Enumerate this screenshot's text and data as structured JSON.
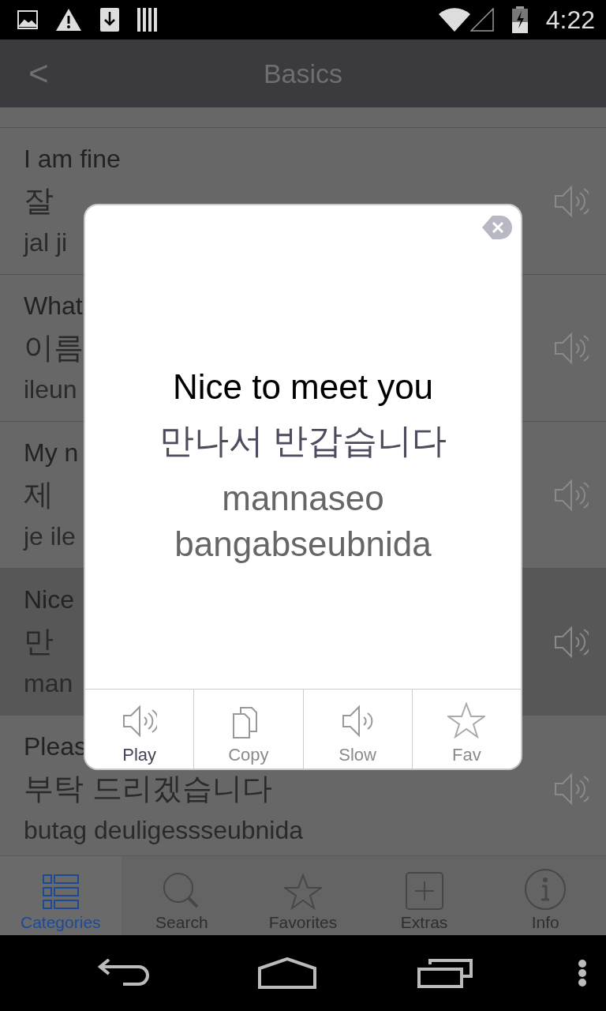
{
  "status_bar": {
    "time": "4:22"
  },
  "header": {
    "back": "<",
    "title": "Basics"
  },
  "phrases": [
    {
      "english": "I am fine",
      "korean": "잘",
      "romanization": "jal ji",
      "highlighted": false
    },
    {
      "english": "What",
      "korean": "이름",
      "romanization": "ileun",
      "highlighted": false
    },
    {
      "english": "My n",
      "korean": "제",
      "romanization": "je ile",
      "highlighted": false
    },
    {
      "english": "Nice",
      "korean": "만",
      "romanization": "man",
      "highlighted": true
    },
    {
      "english": "Pleas",
      "korean": "부탁 드리겠습니다",
      "romanization": "butag deuligessseubnida",
      "highlighted": false
    }
  ],
  "dialog": {
    "english": "Nice to meet you",
    "korean": "만나서 반갑습니다",
    "romanization": "mannaseo bangabseubnida",
    "actions": [
      {
        "kind": "play",
        "label": "Play",
        "highlighted": true
      },
      {
        "kind": "copy",
        "label": "Copy",
        "highlighted": false
      },
      {
        "kind": "slow",
        "label": "Slow",
        "highlighted": false
      },
      {
        "kind": "fav",
        "label": "Fav",
        "highlighted": false
      }
    ]
  },
  "tabs": [
    {
      "kind": "categories",
      "label": "Categories",
      "selected": true
    },
    {
      "kind": "search",
      "label": "Search",
      "selected": false
    },
    {
      "kind": "favorites",
      "label": "Favorites",
      "selected": false
    },
    {
      "kind": "extras",
      "label": "Extras",
      "selected": false
    },
    {
      "kind": "info",
      "label": "Info",
      "selected": false
    }
  ]
}
